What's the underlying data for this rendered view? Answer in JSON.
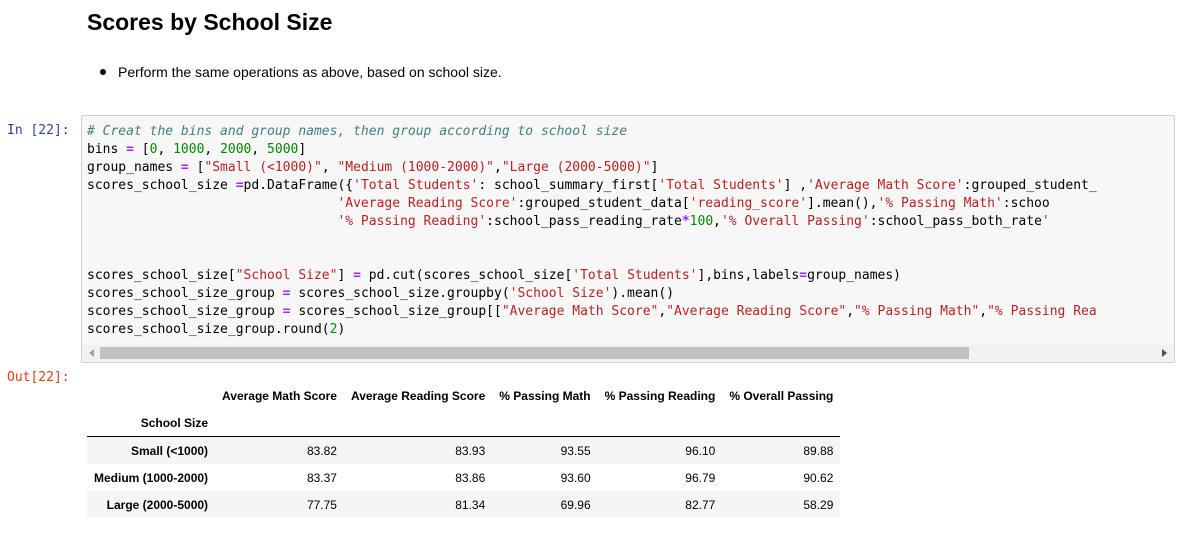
{
  "markdown": {
    "title": "Scores by School Size",
    "bullet": "Perform the same operations as above, based on school size."
  },
  "cell_in": {
    "prompt": "In [22]:"
  },
  "cell_out": {
    "prompt": "Out[22]:"
  },
  "code": {
    "l1_comment": "# Creat the bins and group names, then group according to school size",
    "l2_a": "bins ",
    "l2_op": "=",
    "l2_b": " [",
    "l2_n0": "0",
    "l2_n1": "1000",
    "l2_n2": "2000",
    "l2_n3": "5000",
    "l3_a": "group_names ",
    "l3_op": "=",
    "l3_b": " [",
    "l3_s1": "\"Small (<1000)\"",
    "l3_s2": "\"Medium (1000-2000)\"",
    "l3_s3": "\"Large (2000-5000)\"",
    "l3_c": "]",
    "l4_a": "scores_school_size ",
    "l4_op": "=",
    "l4_b": "pd.DataFrame({",
    "l4_s1": "'Total Students'",
    "l4_c": ": school_summary_first[",
    "l4_s2": "'Total Students'",
    "l4_d": "] ,",
    "l4_s3": "'Average Math Score'",
    "l4_e": ":grouped_student_",
    "l5_pad": "                                ",
    "l5_s1": "'Average Reading Score'",
    "l5_a": ":grouped_student_data[",
    "l5_s2": "'reading_score'",
    "l5_b": "].mean(),",
    "l5_s3": "'% Passing Math'",
    "l5_c": ":schoo",
    "l6_pad": "                                ",
    "l6_s1": "'% Passing Reading'",
    "l6_a": ":school_pass_reading_rate",
    "l6_op": "*",
    "l6_n": "100",
    "l6_b": ",",
    "l6_s2": "'% Overall Passing'",
    "l6_c": ":school_pass_both_rate",
    "l6_s3": "'",
    "l9_a": "scores_school_size[",
    "l9_s1": "\"School Size\"",
    "l9_b": "] ",
    "l9_op": "=",
    "l9_c": " pd.cut(scores_school_size[",
    "l9_s2": "'Total Students'",
    "l9_d": "],bins,labels",
    "l9_op2": "=",
    "l9_e": "group_names)",
    "l10_a": "scores_school_size_group ",
    "l10_op": "=",
    "l10_b": " scores_school_size.groupby(",
    "l10_s": "'School Size'",
    "l10_c": ").mean()",
    "l11_a": "scores_school_size_group ",
    "l11_op": "=",
    "l11_b": " scores_school_size_group[[",
    "l11_s1": "\"Average Math Score\"",
    "l11_s2": "\"Average Reading Score\"",
    "l11_s3": "\"% Passing Math\"",
    "l11_s4": "\"% Passing Rea",
    "l12_a": "scores_school_size_group.round(",
    "l12_n": "2",
    "l12_b": ")"
  },
  "table": {
    "columns": [
      "Average Math Score",
      "Average Reading Score",
      "% Passing Math",
      "% Passing Reading",
      "% Overall Passing"
    ],
    "index_name": "School Size",
    "rows": [
      {
        "label": "Small (<1000)",
        "values": [
          "83.82",
          "83.93",
          "93.55",
          "96.10",
          "89.88"
        ]
      },
      {
        "label": "Medium (1000-2000)",
        "values": [
          "83.37",
          "83.86",
          "93.60",
          "96.79",
          "90.62"
        ]
      },
      {
        "label": "Large (2000-5000)",
        "values": [
          "77.75",
          "81.34",
          "69.96",
          "82.77",
          "58.29"
        ]
      }
    ]
  },
  "icons": {
    "scroll_left": "chevron-left-icon",
    "scroll_right": "chevron-right-icon",
    "bullet": "bullet-dot"
  }
}
